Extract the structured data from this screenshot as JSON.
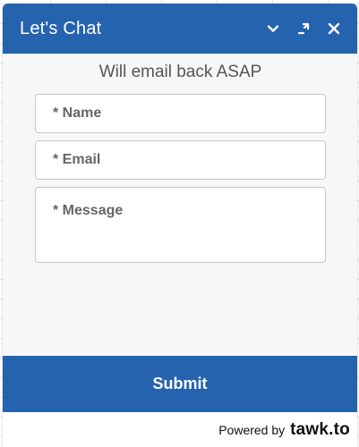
{
  "header": {
    "title": "Let's Chat",
    "icons": [
      "chevron-down-icon",
      "popout-icon",
      "close-icon"
    ]
  },
  "form": {
    "subtitle": "Will email back ASAP",
    "name_placeholder": "* Name",
    "email_placeholder": "* Email",
    "message_placeholder": "* Message"
  },
  "submit_label": "Submit",
  "footer": {
    "powered_by": "Powered by",
    "brand": "tawk.to"
  },
  "colors": {
    "accent": "#2563af",
    "panel_bg": "#f7f7f7"
  }
}
